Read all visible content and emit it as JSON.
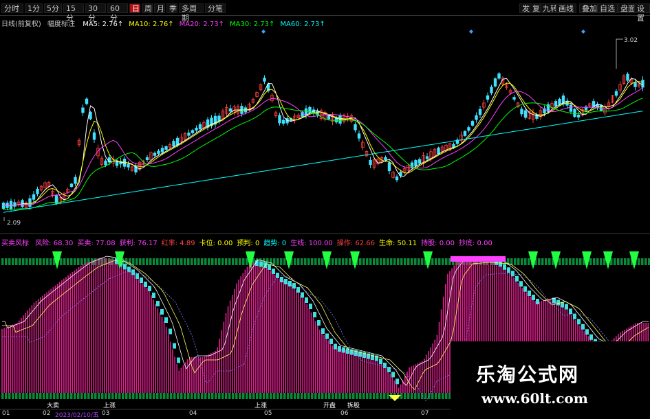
{
  "toolbar": {
    "period_buttons": [
      "分时",
      "1分",
      "5分",
      "15分",
      "30分",
      "60分",
      "日",
      "周",
      "月",
      "季",
      "多周期",
      "分笔"
    ],
    "active_period": "日",
    "right_buttons": [
      "发",
      "复权",
      "九转",
      "画线",
      "叠加",
      "自选",
      "盘面",
      "设置"
    ]
  },
  "main_panel": {
    "legend_prefix": "日线(前复权)",
    "legend_indicator": "幅度标注",
    "ma": [
      {
        "label": "MA5:",
        "value": "2.76",
        "color": "#ffffff"
      },
      {
        "label": "MA10:",
        "value": "2.76",
        "color": "#ffff00"
      },
      {
        "label": "MA20:",
        "value": "2.73",
        "color": "#ff40ff"
      },
      {
        "label": "MA30:",
        "value": "2.73",
        "color": "#00ff00"
      },
      {
        "label": "MA60:",
        "value": "2.73",
        "color": "#00ffff"
      }
    ],
    "high_marker": "3.02",
    "low_marker": "2.09"
  },
  "sub_panel": {
    "name": "买卖风标",
    "items": [
      {
        "label": "风险:",
        "value": "68.30",
        "color": "#ff40ff"
      },
      {
        "label": "买卖:",
        "value": "77.08",
        "color": "#ff40ff"
      },
      {
        "label": "获利:",
        "value": "76.17",
        "color": "#ff40ff"
      },
      {
        "label": "红率:",
        "value": "4.89",
        "color": "#ff4040"
      },
      {
        "label": "卡位:",
        "value": "0.00",
        "color": "#ffff00"
      },
      {
        "label": "预判:",
        "value": "0",
        "color": "#ffff00"
      },
      {
        "label": "趋势:",
        "value": "0",
        "color": "#00ffff"
      },
      {
        "label": "生线:",
        "value": "100.00",
        "color": "#ff40ff"
      },
      {
        "label": "操作:",
        "value": "62.66",
        "color": "#ff4040"
      },
      {
        "label": "生命:",
        "value": "50.11",
        "color": "#ffff00"
      },
      {
        "label": "持股:",
        "value": "0.00",
        "color": "#ff40ff"
      },
      {
        "label": "抄底:",
        "value": "0.00",
        "color": "#ff40ff"
      }
    ]
  },
  "bottom_tags": [
    "大卖",
    "上涨",
    "上涨",
    "开盘",
    "拆股"
  ],
  "xaxis_labels": [
    {
      "text": "01",
      "color": "#d0d0d0"
    },
    {
      "text": "02",
      "color": "#d0d0d0"
    },
    {
      "text": "2023/02/10/五",
      "color": "#b040ff"
    },
    {
      "text": "03",
      "color": "#d0d0d0"
    },
    {
      "text": "04",
      "color": "#d0d0d0"
    },
    {
      "text": "05",
      "color": "#d0d0d0"
    },
    {
      "text": "06",
      "color": "#d0d0d0"
    },
    {
      "text": "07",
      "color": "#d0d0d0"
    }
  ],
  "watermark": {
    "title": "乐淘公式网",
    "url": "www.60lt.com"
  }
}
